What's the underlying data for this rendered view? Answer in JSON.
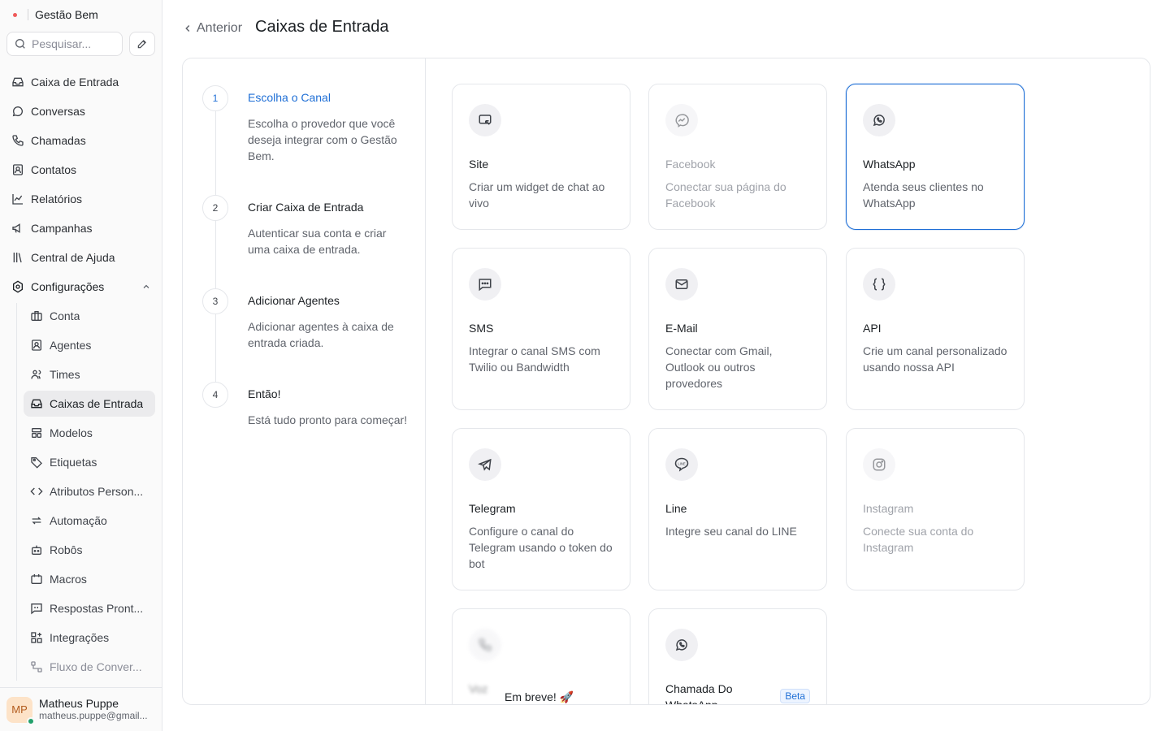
{
  "brand": {
    "name": "Gestão Bem"
  },
  "search": {
    "placeholder": "Pesquisar..."
  },
  "nav": {
    "items": [
      {
        "label": "Caixa de Entrada",
        "icon": "inbox-icon"
      },
      {
        "label": "Conversas",
        "icon": "chat-bubble-icon"
      },
      {
        "label": "Chamadas",
        "icon": "phone-icon"
      },
      {
        "label": "Contatos",
        "icon": "contact-card-icon"
      },
      {
        "label": "Relatórios",
        "icon": "line-chart-icon"
      },
      {
        "label": "Campanhas",
        "icon": "megaphone-icon"
      },
      {
        "label": "Central de Ajuda",
        "icon": "library-icon"
      },
      {
        "label": "Configurações",
        "icon": "settings-icon"
      }
    ],
    "settings_sub": [
      {
        "label": "Conta",
        "icon": "briefcase-icon"
      },
      {
        "label": "Agentes",
        "icon": "user-square-icon"
      },
      {
        "label": "Times",
        "icon": "users-icon"
      },
      {
        "label": "Caixas de Entrada",
        "icon": "inbox-icon"
      },
      {
        "label": "Modelos",
        "icon": "template-icon"
      },
      {
        "label": "Etiquetas",
        "icon": "tag-icon"
      },
      {
        "label": "Atributos Person...",
        "icon": "code-icon"
      },
      {
        "label": "Automação",
        "icon": "repeat-icon"
      },
      {
        "label": "Robôs",
        "icon": "bot-icon"
      },
      {
        "label": "Macros",
        "icon": "calendar-icon"
      },
      {
        "label": "Respostas Pront...",
        "icon": "quote-icon"
      },
      {
        "label": "Integrações",
        "icon": "grid-plus-icon"
      },
      {
        "label": "Fluxo de Conver...",
        "icon": "flow-icon"
      }
    ]
  },
  "user": {
    "name": "Matheus Puppe",
    "email": "matheus.puppe@gmail...",
    "initials": "MP"
  },
  "header": {
    "back_label": "Anterior",
    "title": "Caixas de Entrada"
  },
  "steps": [
    {
      "number": "1",
      "title": "Escolha o Canal",
      "desc": "Escolha o provedor que você deseja integrar com o Gestão Bem."
    },
    {
      "number": "2",
      "title": "Criar Caixa de Entrada",
      "desc": "Autenticar sua conta e criar uma caixa de entrada."
    },
    {
      "number": "3",
      "title": "Adicionar Agentes",
      "desc": "Adicionar agentes à caixa de entrada criada."
    },
    {
      "number": "4",
      "title": "Então!",
      "desc": "Está tudo pronto para começar!"
    }
  ],
  "channels": [
    {
      "title": "Site",
      "desc": "Criar um widget de chat ao vivo",
      "icon": "chat-widget-icon"
    },
    {
      "title": "Facebook",
      "desc": "Conectar sua página do Facebook",
      "icon": "messenger-icon"
    },
    {
      "title": "WhatsApp",
      "desc": "Atenda seus clientes no WhatsApp",
      "icon": "whatsapp-icon"
    },
    {
      "title": "SMS",
      "desc": "Integrar o canal SMS com Twilio ou Bandwidth",
      "icon": "sms-icon"
    },
    {
      "title": "E-Mail",
      "desc": "Conectar com Gmail, Outlook ou outros provedores",
      "icon": "mail-icon"
    },
    {
      "title": "API",
      "desc": "Crie um canal personalizado usando nossa API",
      "icon": "braces-icon"
    },
    {
      "title": "Telegram",
      "desc": "Configure o canal do Telegram usando o token do bot",
      "icon": "telegram-icon"
    },
    {
      "title": "Line",
      "desc": "Integre seu canal do LINE",
      "icon": "line-icon"
    },
    {
      "title": "Instagram",
      "desc": "Conecte sua conta do Instagram",
      "icon": "instagram-icon"
    },
    {
      "title": "Voz",
      "soon_label": "Em breve! 🚀",
      "icon": "phone-icon"
    },
    {
      "title": "Chamada Do WhatsApp",
      "badge": "Beta",
      "icon": "whatsapp-icon"
    }
  ],
  "colors": {
    "accent": "#1f6fd6",
    "active_bg": "#ebebed"
  }
}
